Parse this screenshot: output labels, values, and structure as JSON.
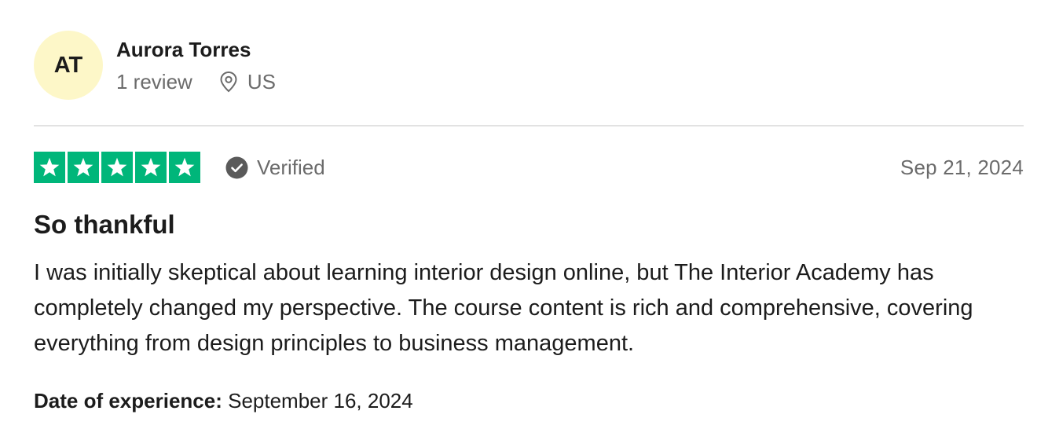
{
  "reviewer": {
    "initials": "AT",
    "name": "Aurora Torres",
    "review_count": "1 review",
    "location": "US",
    "avatar_color": "#fdf7c8"
  },
  "review": {
    "rating": 5,
    "rating_max": 5,
    "star_color": "#00b67a",
    "verified_label": "Verified",
    "date": "Sep 21, 2024",
    "title": "So thankful",
    "body": "I was initially skeptical about learning interior design online, but The Interior Academy has completely changed my perspective. The course content is rich and comprehensive, covering everything from design principles to business management.",
    "experience_label": "Date of experience:",
    "experience_date": "September 16, 2024"
  },
  "icons": {
    "location": "map-pin-icon",
    "verified": "check-circle-icon",
    "star": "star-icon"
  }
}
